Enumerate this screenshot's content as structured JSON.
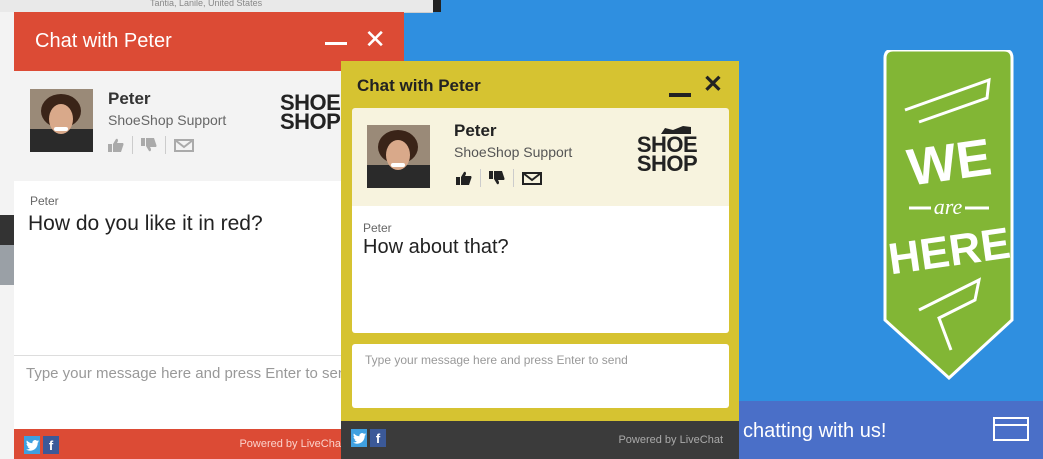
{
  "background": {
    "address_snippet": "Tańtia, Lanile, United States"
  },
  "chat_red": {
    "title": "Chat with Peter",
    "agent_name": "Peter",
    "agent_role": "ShoeShop Support",
    "logo_line1": "SHOE",
    "logo_line2": "SHOP",
    "sender": "Peter",
    "message": "How do you like it in red?",
    "input_placeholder": "Type your message here and press Enter to send",
    "powered": "Powered by LiveChat",
    "accent": "#dc4b35"
  },
  "chat_yellow": {
    "title": "Chat with Peter",
    "agent_name": "Peter",
    "agent_role": "ShoeShop Support",
    "logo_line1": "SHOE",
    "logo_line2": "SHOP",
    "sender": "Peter",
    "message": "How about that?",
    "input_placeholder": "Type your message here and press Enter to send",
    "powered": "Powered by LiveChat",
    "accent": "#d6c331"
  },
  "badge": {
    "line1": "WE",
    "line2": "are",
    "line3": "HERE",
    "color": "#82b635"
  },
  "chat_bar": {
    "text": "chatting with us!",
    "color": "#4a6fc8"
  },
  "social": {
    "twitter": "t",
    "facebook": "f"
  }
}
